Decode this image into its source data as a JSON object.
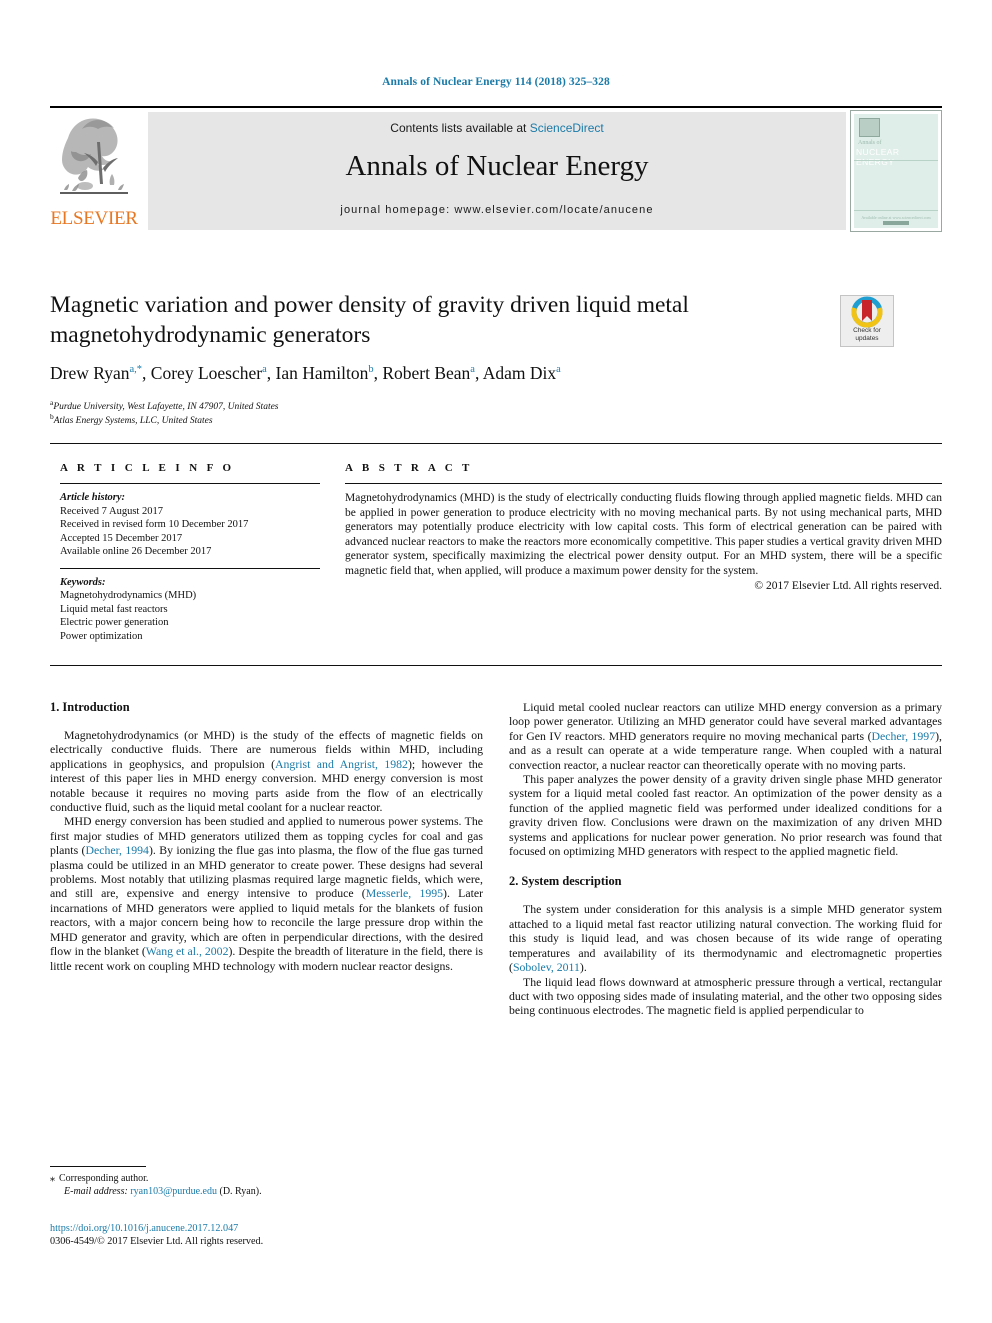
{
  "running_head": "Annals of Nuclear Energy 114 (2018) 325–328",
  "masthead": {
    "contents_prefix": "Contents lists available at ",
    "contents_link": "ScienceDirect",
    "journal_name": "Annals of Nuclear Energy",
    "homepage_prefix": "journal homepage: ",
    "homepage_url": "www.elsevier.com/locate/anucene",
    "publisher_logo_text": "ELSEVIER",
    "publisher_logo_icon": "elsevier-tree-icon",
    "cover": {
      "line1": "Annals of",
      "line2": "NUCLEAR ENERGY",
      "footer": "Available online at www.sciencedirect.com"
    },
    "bg_color": "#e6e6e6",
    "link_color": "#1a7aa8",
    "logo_color": "#E87722"
  },
  "article": {
    "title": "Magnetic variation and power density of gravity driven liquid metal magnetohydrodynamic generators",
    "crossmark": {
      "label_line1": "Check for",
      "label_line2": "updates",
      "icon": "crossmark-badge-icon"
    },
    "authors": [
      {
        "name": "Drew Ryan",
        "sup": "a,*"
      },
      {
        "name": "Corey Loescher",
        "sup": "a"
      },
      {
        "name": "Ian Hamilton",
        "sup": "b"
      },
      {
        "name": "Robert Bean",
        "sup": "a"
      },
      {
        "name": "Adam Dix",
        "sup": "a"
      }
    ],
    "affiliations": [
      {
        "marker": "a",
        "text": "Purdue University, West Lafayette, IN 47907, United States"
      },
      {
        "marker": "b",
        "text": "Atlas Energy Systems, LLC, United States"
      }
    ]
  },
  "article_info": {
    "heading": "A R T I C L E   I N F O",
    "history_label": "Article history:",
    "history": [
      "Received 7 August 2017",
      "Received in revised form 10 December 2017",
      "Accepted 15 December 2017",
      "Available online 26 December 2017"
    ],
    "keywords_label": "Keywords:",
    "keywords": [
      "Magnetohydrodynamics (MHD)",
      "Liquid metal fast reactors",
      "Electric power generation",
      "Power optimization"
    ]
  },
  "abstract": {
    "heading": "A B S T R A C T",
    "text": "Magnetohydrodynamics (MHD) is the study of electrically conducting fluids flowing through applied magnetic fields. MHD can be applied in power generation to produce electricity with no moving mechanical parts. By not using mechanical parts, MHD generators may potentially produce electricity with low capital costs. This form of electrical generation can be paired with advanced nuclear reactors to make the reactors more economically competitive. This paper studies a vertical gravity driven MHD generator system, specifically maximizing the electrical power density output. For an MHD system, there will be a specific magnetic field that, when applied, will produce a maximum power density for the system.",
    "copyright": "© 2017 Elsevier Ltd. All rights reserved."
  },
  "body": {
    "left_column": {
      "section_heading": "1. Introduction",
      "paragraphs": [
        {
          "parts": [
            {
              "t": "Magnetohydrodynamics (or MHD) is the study of the effects of magnetic fields on electrically conductive fluids. There are numerous fields within MHD, including applications in geophysics, and propulsion (",
              "link": false
            },
            {
              "t": "Angrist and Angrist, 1982",
              "link": true
            },
            {
              "t": "); however the interest of this paper lies in MHD energy conversion. MHD energy conversion is most notable because it requires no moving parts aside from the flow of an electrically conductive fluid, such as the liquid metal coolant for a nuclear reactor.",
              "link": false
            }
          ]
        },
        {
          "parts": [
            {
              "t": "MHD energy conversion has been studied and applied to numerous power systems. The first major studies of MHD generators utilized them as topping cycles for coal and gas plants (",
              "link": false
            },
            {
              "t": "Decher, 1994",
              "link": true
            },
            {
              "t": "). By ionizing the flue gas into plasma, the flow of the flue gas turned plasma could be utilized in an MHD generator to create power. These designs had several problems. Most notably that utilizing plasmas required large magnetic fields, which were, and still are, expensive and energy intensive to produce (",
              "link": false
            },
            {
              "t": "Messerle, 1995",
              "link": true
            },
            {
              "t": "). Later incarnations of MHD generators were applied to liquid metals for the blankets of fusion reactors, with a major concern being how to reconcile the large pressure drop within the MHD generator and gravity, which are often in perpendicular directions, with the desired flow in the blanket (",
              "link": false
            },
            {
              "t": "Wang et al., 2002",
              "link": true
            },
            {
              "t": "). Despite the breadth of literature in the field, there is little recent work on coupling MHD technology with modern nuclear reactor designs.",
              "link": false
            }
          ]
        }
      ]
    },
    "right_column": {
      "paragraphs": [
        {
          "parts": [
            {
              "t": "Liquid metal cooled nuclear reactors can utilize MHD energy conversion as a primary loop power generator. Utilizing an MHD generator could have several marked advantages for Gen IV reactors. MHD generators require no moving mechanical parts (",
              "link": false
            },
            {
              "t": "Decher, 1997",
              "link": true
            },
            {
              "t": "), and as a result can operate at a wide temperature range. When coupled with a natural convection reactor, a nuclear reactor can theoretically operate with no moving parts.",
              "link": false
            }
          ]
        },
        {
          "parts": [
            {
              "t": "This paper analyzes the power density of a gravity driven single phase MHD generator system for a liquid metal cooled fast reactor. An optimization of the power density as a function of the applied magnetic field was performed under idealized conditions for a gravity driven flow. Conclusions were drawn on the maximization of any driven MHD systems and applications for nuclear power generation. No prior research was found that focused on optimizing MHD generators with respect to the applied magnetic field.",
              "link": false
            }
          ]
        }
      ],
      "section_heading": "2. System description",
      "paragraphs2": [
        {
          "parts": [
            {
              "t": "The system under consideration for this analysis is a simple MHD generator system attached to a liquid metal fast reactor utilizing natural convection. The working fluid for this study is liquid lead, and was chosen because of its wide range of operating temperatures and availability of its thermodynamic and electromagnetic properties (",
              "link": false
            },
            {
              "t": "Sobolev, 2011",
              "link": true
            },
            {
              "t": ").",
              "link": false
            }
          ]
        },
        {
          "parts": [
            {
              "t": "The liquid lead flows downward at atmospheric pressure through a vertical, rectangular duct with two opposing sides made of insulating material, and the other two opposing sides being continuous electrodes. The magnetic field is applied perpendicular to",
              "link": false
            }
          ]
        }
      ]
    }
  },
  "footnotes": {
    "corresponding_marker": "⁎",
    "corresponding_text": "Corresponding author.",
    "email_label": "E-mail address:",
    "email": "ryan103@purdue.edu",
    "email_owner": "(D. Ryan)."
  },
  "page_footer": {
    "doi": "https://doi.org/10.1016/j.anucene.2017.12.047",
    "issn_line": "0306-4549/© 2017 Elsevier Ltd. All rights reserved."
  }
}
